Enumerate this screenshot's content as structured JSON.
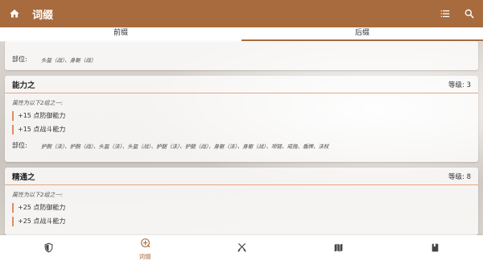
{
  "appbar": {
    "title": "词缀",
    "home_icon": "home-icon",
    "list_icon": "list-icon",
    "search_icon": "search-icon",
    "color": "#a86b3d"
  },
  "tabs": [
    {
      "label": "前缀",
      "active": false
    },
    {
      "label": "后缀",
      "active": true
    }
  ],
  "cards": [
    {
      "parts_label": "部位:",
      "parts_value": "头盔（战）、身躯（战）"
    },
    {
      "title": "能力之",
      "level": "等级: 3",
      "intro": "属性为以下2组之一:",
      "attrs": [
        "+15 点防御能力",
        "+15 点战斗能力"
      ],
      "parts_label": "部位:",
      "parts_value": "护腕（法）、护腕（战）、头盔（法）、头盔（战）、护腿（法）、护腿（战）、身躯（法）、身躯（战）、项链、戒指、盾牌、法杖"
    },
    {
      "title": "精通之",
      "level": "等级: 8",
      "intro": "属性为以下2组之一:",
      "attrs": [
        "+25 点防御能力",
        "+25 点战斗能力"
      ]
    }
  ],
  "bottomnav": [
    {
      "icon": "shield-icon",
      "label": ""
    },
    {
      "icon": "affix-icon",
      "label": "词缀",
      "active": true
    },
    {
      "icon": "utensils-icon",
      "label": ""
    },
    {
      "icon": "map-icon",
      "label": ""
    },
    {
      "icon": "book-icon",
      "label": ""
    }
  ]
}
